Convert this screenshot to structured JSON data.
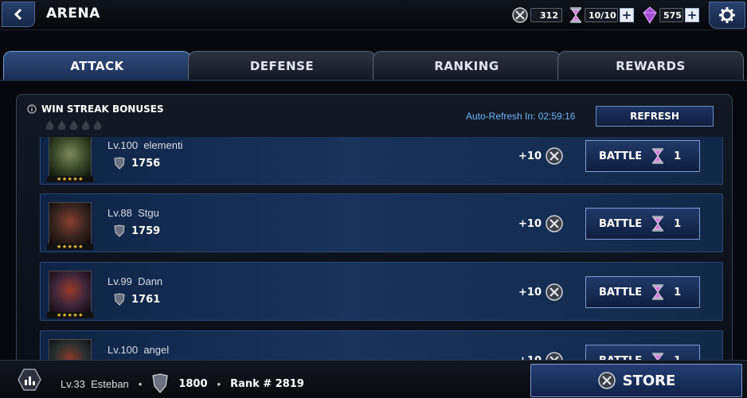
{
  "header": {
    "title": "ARENA",
    "currency": [
      {
        "icon": "arena-coin-icon",
        "value": "312"
      },
      {
        "icon": "hourglass-icon",
        "value": "10/10"
      },
      {
        "icon": "crystal-icon",
        "value": "575"
      }
    ]
  },
  "tabs": [
    "ATTACK",
    "DEFENSE",
    "RANKING",
    "REWARDS"
  ],
  "active_tab": "ATTACK",
  "win_streak": {
    "label": "WIN STREAK BONUSES",
    "flames": 5
  },
  "auto_refresh": "Auto-Refresh In: 02:59:16",
  "refresh_label": "REFRESH",
  "opponents": [
    {
      "level": "Lv.100",
      "name": "elementi",
      "rating": "1756",
      "reward": "+10",
      "battle_label": "BATTLE",
      "cost": "1",
      "stars": "★★★★★"
    },
    {
      "level": "Lv.88",
      "name": "Stgu",
      "rating": "1759",
      "reward": "+10",
      "battle_label": "BATTLE",
      "cost": "1",
      "stars": "★★★★★"
    },
    {
      "level": "Lv.99",
      "name": "Dann",
      "rating": "1761",
      "reward": "+10",
      "battle_label": "BATTLE",
      "cost": "1",
      "stars": "★★★★★"
    },
    {
      "level": "Lv.100",
      "name": "angel",
      "rating": "",
      "reward": "+10",
      "battle_label": "BATTLE",
      "cost": "1",
      "stars": "★★★★★"
    }
  ],
  "player": {
    "level": "Lv.33",
    "name": "Esteban",
    "rating": "1800",
    "rank": "Rank # 2819"
  },
  "store_label": "STORE",
  "colors": {
    "accent": "#6db4ff",
    "button": "#213a6a",
    "row": "#18335c",
    "star": "#f4c431"
  }
}
